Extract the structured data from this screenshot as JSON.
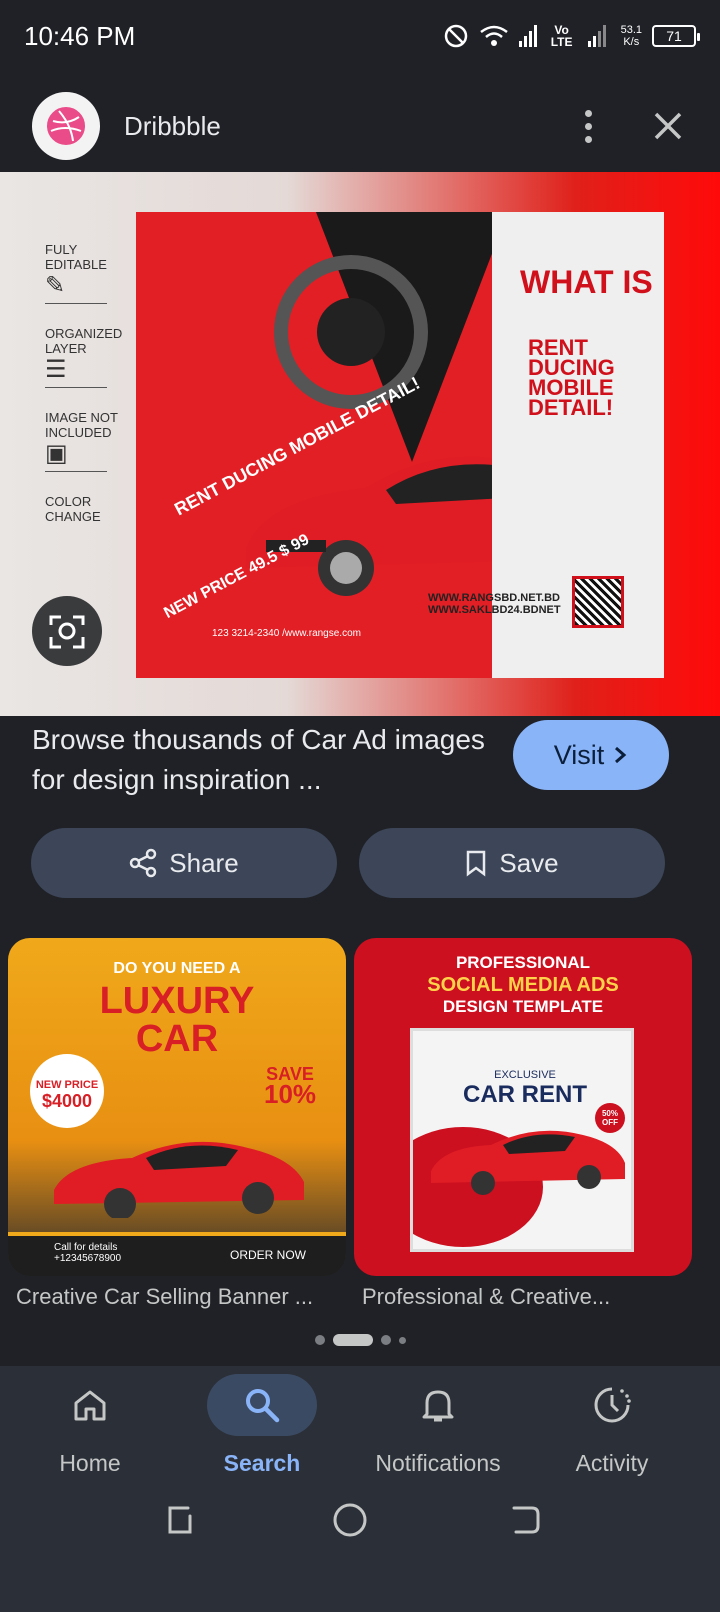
{
  "status_bar": {
    "time": "10:46 PM",
    "network_label": "Vo LTE",
    "speed_value": "53.1",
    "speed_unit": "K/s",
    "battery": "71"
  },
  "header": {
    "site_name": "Dribbble",
    "logo_icon": "dribbble-icon",
    "menu_icon": "more-vert-icon",
    "close_icon": "close-icon"
  },
  "hero": {
    "side_items": [
      "FULY EDITABLE",
      "ORGANIZED LAYER",
      "IMAGE NOT INCLUDED",
      "COLOR CHANGE"
    ],
    "poster_heading": "WHAT IS",
    "poster_text": "RENT DUCING MOBILE DETAIL!",
    "poster_text_left": "RENT DUCING MOBILE DETAIL!",
    "poster_price": "NEW PRICE 49.5 $ 99",
    "poster_phone": "123 3214-2340 /www.rangse.com",
    "poster_web1": "WWW.RANGSBD.NET.BD",
    "poster_web2": "WWW.SAKLBD24.BDNET",
    "lens_icon": "google-lens-icon"
  },
  "caption": "Browse thousands of Car Ad images for design inspiration ...",
  "visit_label": "Visit",
  "share_label": "Share",
  "save_label": "Save",
  "related": [
    {
      "title": "Creative Car Selling Banner ...",
      "top": "DO YOU NEED A",
      "headline1": "LUXURY",
      "headline2": "CAR",
      "badge_top": "NEW PRICE",
      "badge_price": "$4000",
      "save_line1": "SAVE",
      "save_line2": "10%",
      "footer_left1": "Call for details",
      "footer_left2": "+12345678900",
      "footer_right": "ORDER NOW"
    },
    {
      "title": "Professional & Creative...",
      "head1": "PROFESSIONAL",
      "head2": "SOCIAL MEDIA ADS",
      "head3": "DESIGN TEMPLATE",
      "exclusive": "EXCLUSIVE",
      "car_rent": "CAR RENT",
      "off": "50% OFF"
    }
  ],
  "pager": {
    "count": 4,
    "active": 1
  },
  "bottom_nav": [
    {
      "label": "Home",
      "icon": "home-icon"
    },
    {
      "label": "Search",
      "icon": "search-icon"
    },
    {
      "label": "Notifications",
      "icon": "bell-icon"
    },
    {
      "label": "Activity",
      "icon": "activity-icon"
    }
  ],
  "colors": {
    "background": "#1f2126",
    "accent": "#8ab4f8",
    "pill": "#3c4658",
    "nav_bg": "#2b2f38"
  }
}
